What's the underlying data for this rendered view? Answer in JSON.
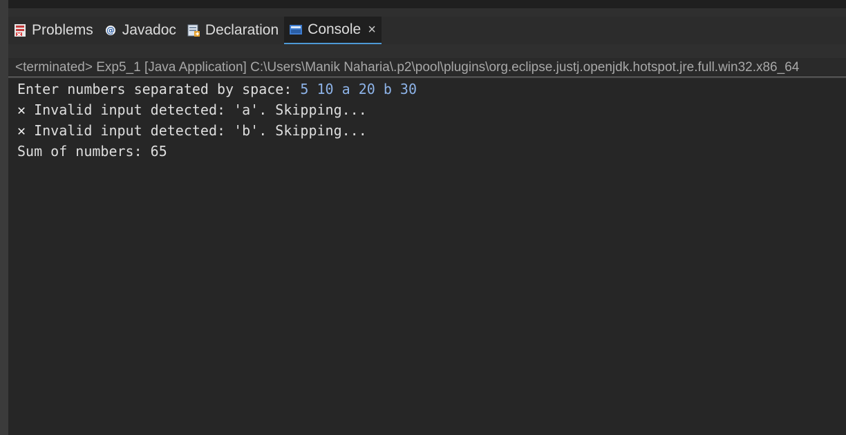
{
  "tabs": [
    {
      "label": "Problems",
      "icon": "problems-icon"
    },
    {
      "label": "Javadoc",
      "icon": "javadoc-icon"
    },
    {
      "label": "Declaration",
      "icon": "declaration-icon"
    },
    {
      "label": "Console",
      "icon": "console-icon",
      "active": true,
      "close": "×"
    }
  ],
  "status": "<terminated> Exp5_1 [Java Application] C:\\Users\\Manik Naharia\\.p2\\pool\\plugins\\org.eclipse.justj.openjdk.hotspot.jre.full.win32.x86_64",
  "console": {
    "prompt": "Enter numbers separated by space: ",
    "user_input": "5 10 a 20 b 30",
    "error_mark": "✕",
    "error_lines": [
      " Invalid input detected: 'a'. Skipping...",
      " Invalid input detected: 'b'. Skipping..."
    ],
    "result": "Sum of numbers: 65"
  },
  "colors": {
    "background": "#262626",
    "input_text": "#8db3e8",
    "active_tab_underline": "#4e9ad6"
  }
}
